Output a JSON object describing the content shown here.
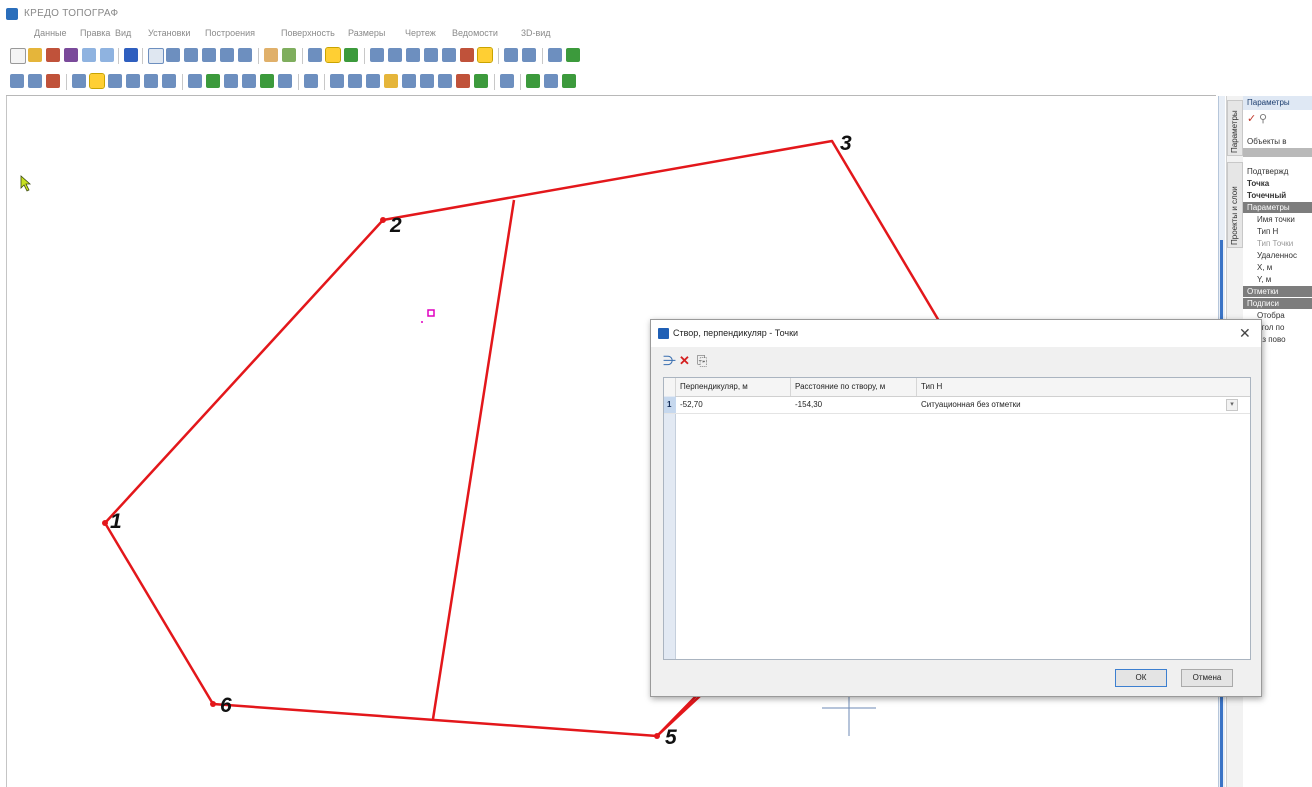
{
  "app": {
    "title": "КРЕДО ТОПОГРАФ"
  },
  "menu": [
    "Данные",
    "Правка",
    "Вид",
    "Установки",
    "Построения",
    "Поверхность",
    "Размеры",
    "Чертеж",
    "Ведомости",
    "3D-вид"
  ],
  "points": [
    {
      "label": "1"
    },
    {
      "label": "2"
    },
    {
      "label": "3"
    },
    {
      "label": "5"
    },
    {
      "label": "6"
    }
  ],
  "side_tabs": [
    "Параметры",
    "Проекты и слои"
  ],
  "params_panel": {
    "title": "Параметры",
    "rows": [
      "Объекты в",
      "",
      "Подтвержд",
      "Точка",
      "Точечный",
      "Параметры",
      "Имя точки",
      "Тип Н",
      "Тип Точки",
      "Удаленнос",
      "X, м",
      "Y, м",
      "Отметки",
      "Подписи",
      "Отобра",
      "Угол по",
      "Аз пово"
    ]
  },
  "dialog": {
    "title": "Створ, перпендикуляр - Точки",
    "columns": [
      "Перпендикуляр, м",
      "Расстояние по створу, м",
      "Тип Н"
    ],
    "rows": [
      {
        "num": "1",
        "perp": "-52,70",
        "dist": "-154,30",
        "type": "Ситуационная без отметки"
      }
    ],
    "ok_label": "ОК",
    "cancel_label": "Отмена"
  },
  "colors": {
    "polygon_line": "#e3171b",
    "selected_point_marker": "#e000c0",
    "dialog_accent": "#1f5fb5"
  },
  "icons": [
    "cursor-arrow-icon",
    "insert-row-icon",
    "delete-icon",
    "copy-icon",
    "close-icon",
    "apply-check-icon",
    "filter-icon"
  ]
}
